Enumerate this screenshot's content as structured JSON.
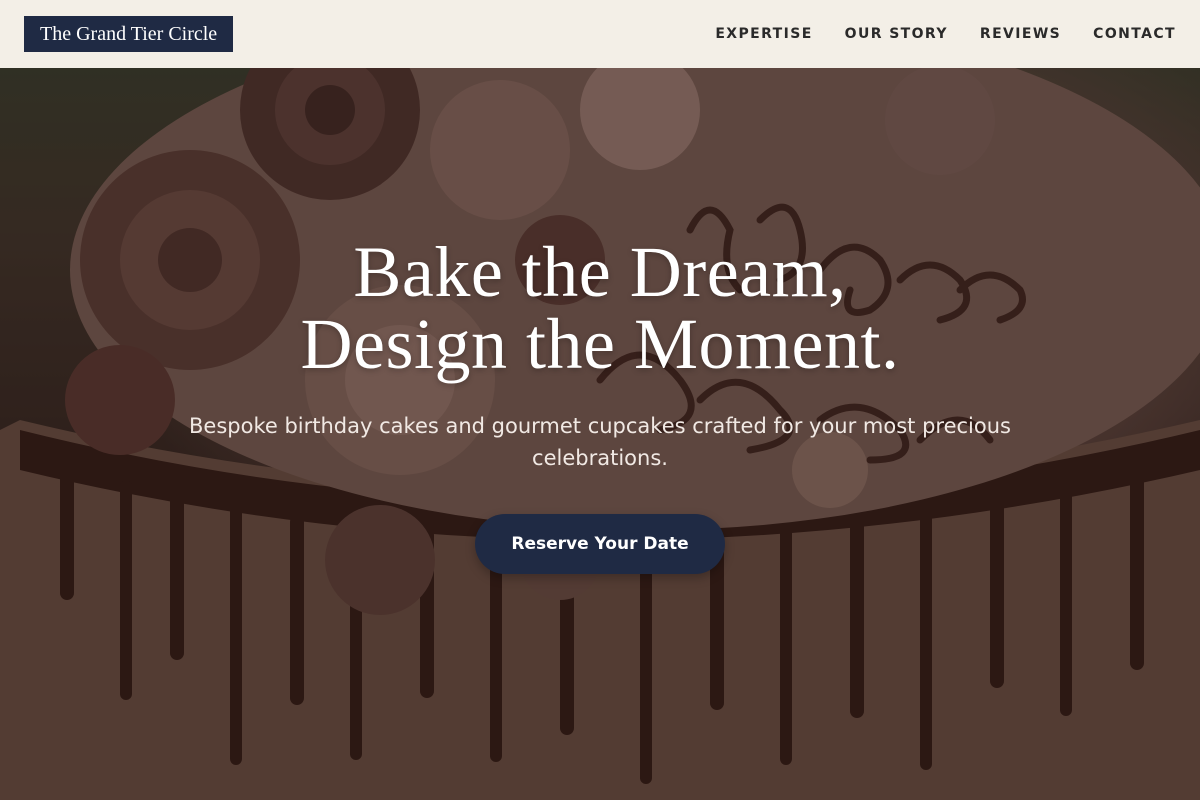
{
  "navbar": {
    "brand": "The Grand Tier Circle",
    "links": [
      "EXPERTISE",
      "OUR STORY",
      "REVIEWS",
      "CONTACT"
    ]
  },
  "hero": {
    "title_line1": "Bake the Dream,",
    "title_line2": "Design the Moment.",
    "subtitle": "Bespoke birthday cakes and gourmet cupcakes crafted for your most precious celebrations.",
    "cta_label": "Reserve Your Date",
    "background_image": "chocolate drip birthday cake with piped buttercream roses and \"Happy Birthday\" lettering"
  },
  "colors": {
    "navy": "#1f2a44",
    "nav_bg": "#f3efe7",
    "nav_text": "#2a2a2a",
    "white": "#ffffff"
  }
}
